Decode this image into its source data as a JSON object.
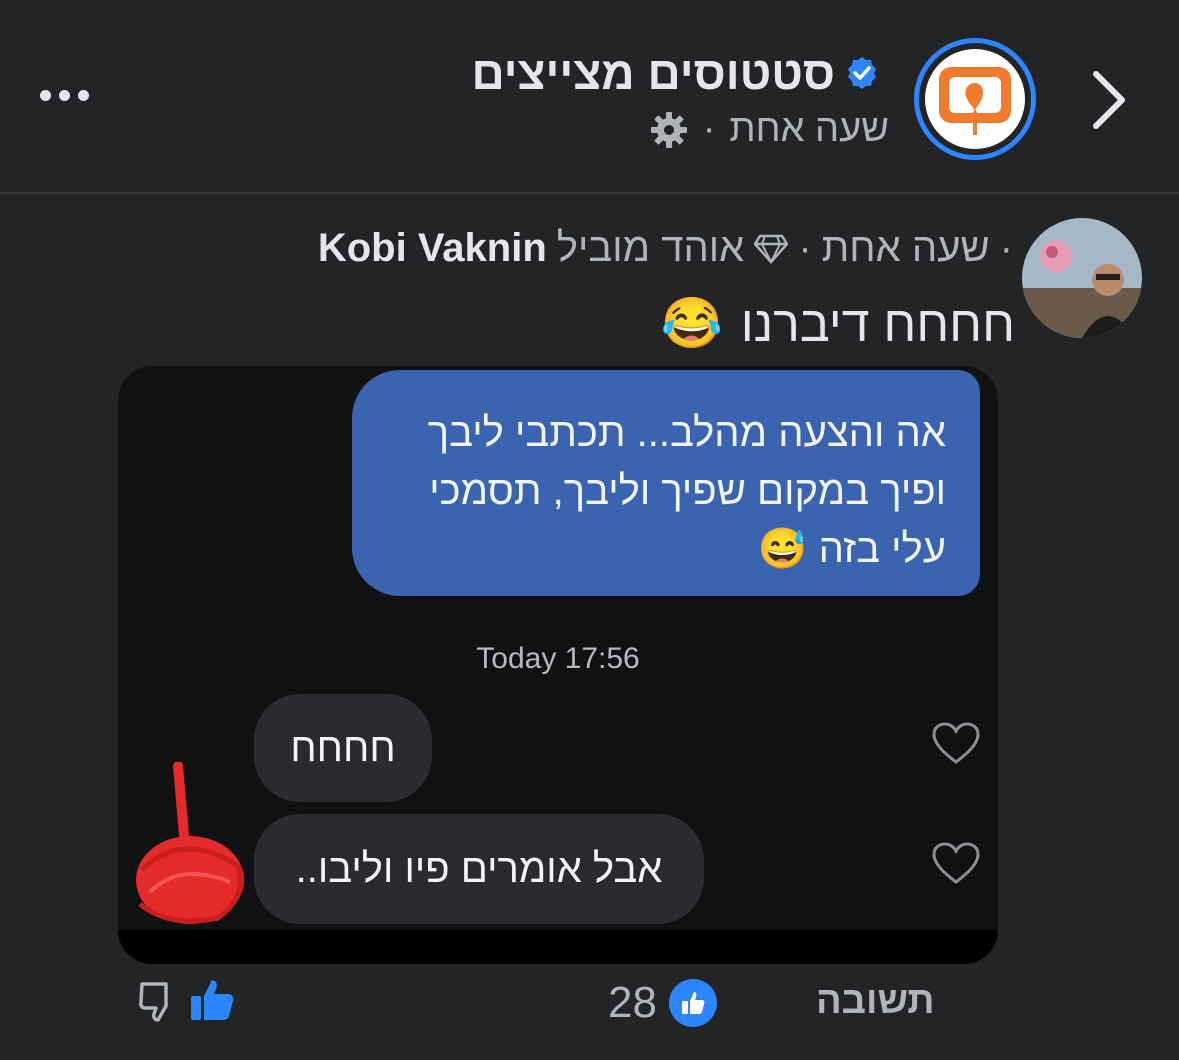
{
  "header": {
    "page_name": "סטטוסים מצייצים",
    "time": "שעה אחת",
    "separator": "·"
  },
  "comment": {
    "author": "Kobi Vaknin",
    "badge_label": "אוהד מוביל",
    "time": "שעה אחת",
    "separator": "·",
    "text": "חחחח דיברנו",
    "emoji": "😂"
  },
  "screenshot": {
    "outgoing_lines": [
      "אה והצעה מהלב... תכתבי ליבך",
      "ופיך במקום שפיך וליבך, תסמכי",
      "עלי בזה"
    ],
    "outgoing_emoji": "😅",
    "timestamp": "Today 17:56",
    "incoming": [
      "חחחח",
      "אבל אומרים פיו וליבו.."
    ]
  },
  "footer": {
    "reply_label": "תשובה",
    "like_count": "28"
  },
  "colors": {
    "background": "#232426",
    "accent": "#2d86ff",
    "outgoing_bubble": "#3b64b0",
    "incoming_bubble": "#2a2b2e",
    "logo_orange": "#f07b2e"
  },
  "icons": [
    "chevron-right-icon",
    "more-icon",
    "verified-icon",
    "gear-icon",
    "diamond-icon",
    "heart-icon",
    "like-icon",
    "dislike-icon"
  ]
}
